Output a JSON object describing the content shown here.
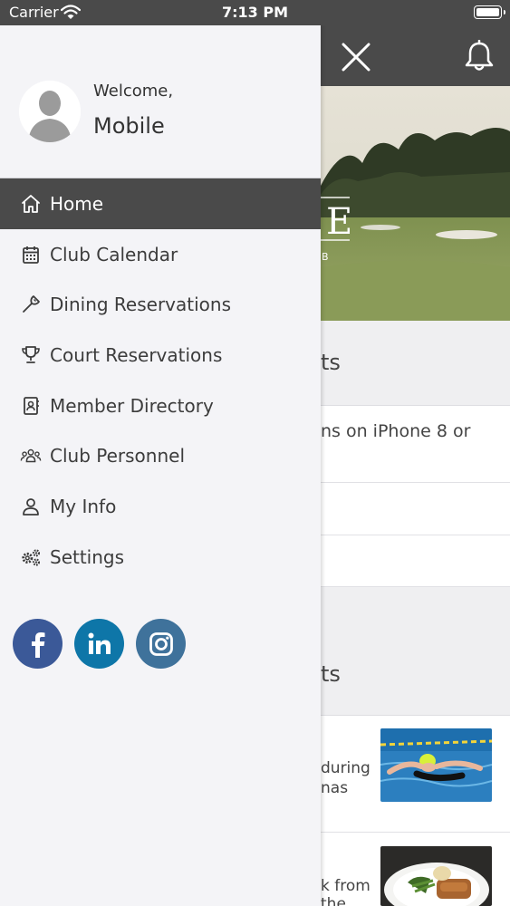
{
  "status_bar": {
    "carrier": "Carrier",
    "time": "7:13 PM"
  },
  "drawer": {
    "welcome": "Welcome,",
    "username": "Mobile",
    "menu": [
      {
        "label": "Home",
        "icon": "home-icon",
        "active": true
      },
      {
        "label": "Club Calendar",
        "icon": "calendar-icon"
      },
      {
        "label": "Dining Reservations",
        "icon": "utensils-icon"
      },
      {
        "label": "Court Reservations",
        "icon": "trophy-icon"
      },
      {
        "label": "Member Directory",
        "icon": "directory-icon"
      },
      {
        "label": "Club Personnel",
        "icon": "people-icon"
      },
      {
        "label": "My Info",
        "icon": "user-icon"
      },
      {
        "label": "Settings",
        "icon": "gears-icon"
      }
    ],
    "social": [
      {
        "name": "facebook",
        "color": "#3b5998"
      },
      {
        "name": "linkedin",
        "color": "#0e76a8"
      },
      {
        "name": "instagram",
        "color": "#3f729b"
      }
    ]
  },
  "background": {
    "hero_text_fragment": "E",
    "hero_sub_fragment": "B",
    "section1_heading_fragment": "ts",
    "notice_fragment": "ns on iPhone 8 or",
    "section2_heading_fragment": "ts",
    "news1_line1": "during",
    "news1_line2": "nas",
    "news2_line1": "k from",
    "news2_line2": "the"
  },
  "colors": {
    "header": "#4a4a4a",
    "drawer_bg": "#f4f4f7",
    "text": "#3c3c3c"
  }
}
